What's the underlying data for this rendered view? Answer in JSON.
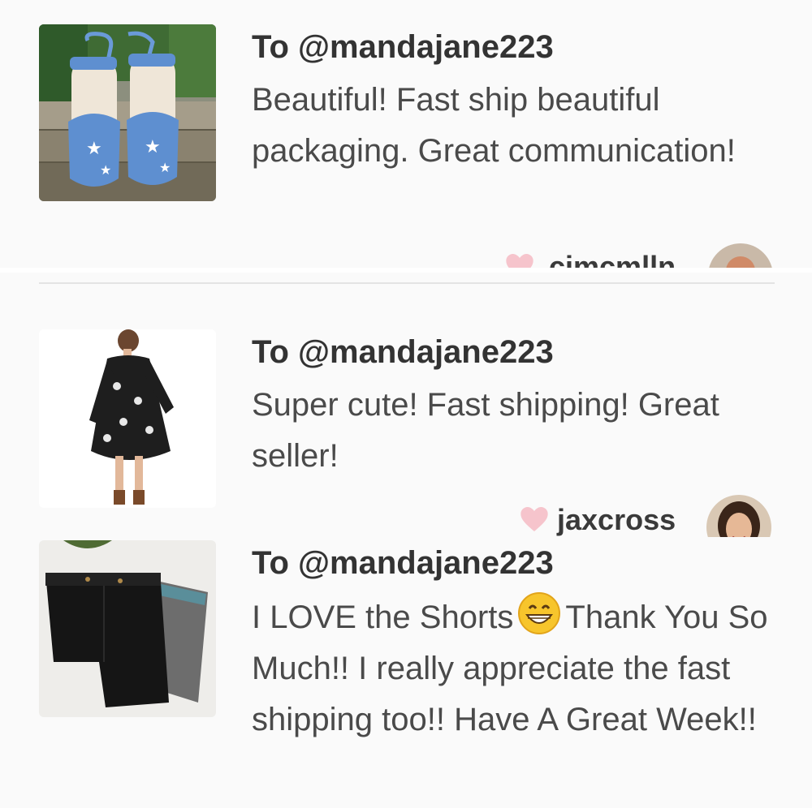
{
  "reviews": [
    {
      "to_label": "To @mandajane223",
      "comment": "Beautiful! Fast ship beautiful packaging. Great communication!",
      "buyer_username": "cimcmlln",
      "item_image": "espadrille-sandals-photo",
      "avatar_image": "user-avatar-photo"
    },
    {
      "to_label": "To @mandajane223",
      "comment": "Super cute! Fast shipping! Great seller!",
      "buyer_username": "jaxcross",
      "item_image": "black-floral-dress-photo",
      "avatar_image": "user-avatar-photo"
    },
    {
      "to_label": "To @mandajane223",
      "comment_before_emoji": "I LOVE the Shorts",
      "comment_after_emoji": "Thank You So Much!! I really appreciate the fast shipping too!! Have A Great Week!!",
      "emoji": "grinning-face-emoji",
      "item_image": "shorts-photo"
    }
  ],
  "colors": {
    "panel_bg": "#fafafa",
    "text": "#4a4a4a",
    "heart": "#f6c4cc",
    "divider": "#e3e3e3"
  },
  "icons": {
    "like": "heart-icon"
  }
}
